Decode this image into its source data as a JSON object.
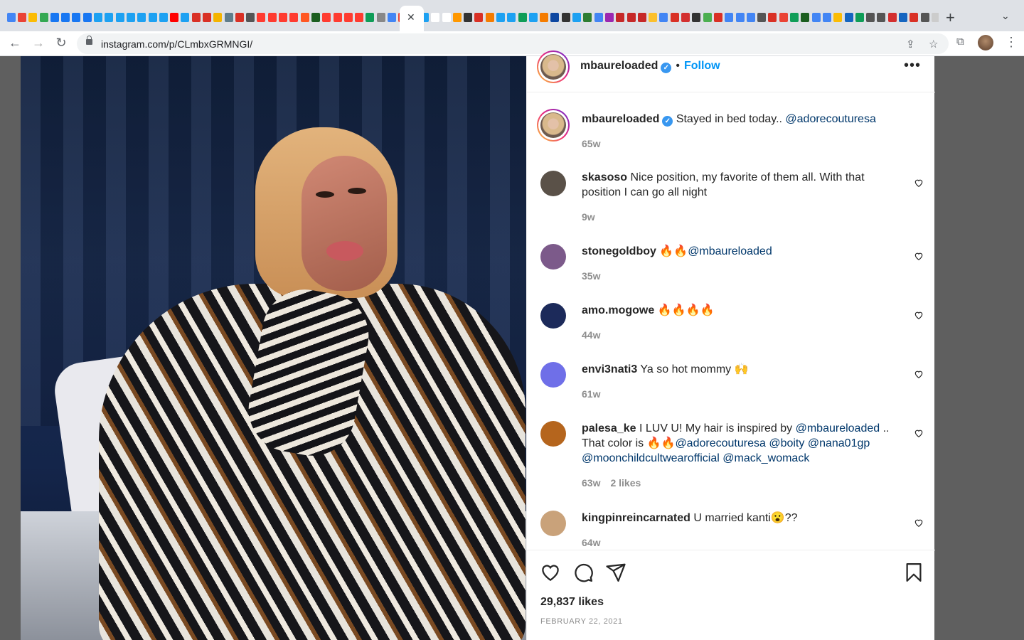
{
  "browser": {
    "url": "instagram.com/p/CLmbxGRMNGI/",
    "tab_close": "✕",
    "new_tab": "+",
    "tab_search": "⌄",
    "back": "←",
    "forward": "→",
    "reload": "↻",
    "share": "⇪",
    "bookmark": "☆",
    "extensions": "⧉",
    "menu": "⋮",
    "tab_favicon_colors": [
      "#4285f4",
      "#ea4335",
      "#fbbc05",
      "#34a853",
      "#1877f2",
      "#1877f2",
      "#1877f2",
      "#1877f2",
      "#1da1f2",
      "#1da1f2",
      "#1da1f2",
      "#1da1f2",
      "#1da1f2",
      "#1da1f2",
      "#1da1f2",
      "#ff0000",
      "#1da1f2",
      "#d93025",
      "#d93025",
      "#f4b400",
      "#607d8b",
      "#d93025",
      "#555555",
      "#ff3b30",
      "#ff3b30",
      "#ff3b30",
      "#ff3b30",
      "#ff5722",
      "#1b5e20",
      "#ff3b30",
      "#ff3b30",
      "#ff3b30",
      "#ff3b30",
      "#0f9d58",
      "#888888",
      "#4285f4",
      "#ea4335",
      "#f4b400",
      "#1da1f2"
    ],
    "tab_favicon_colors_right": [
      "#ff9800",
      "#333333",
      "#d93025",
      "#f57c00",
      "#1da1f2",
      "#1da1f2",
      "#0f9d58",
      "#1da1f2",
      "#f57c00",
      "#0d47a1",
      "#333333",
      "#1da1f2",
      "#2e7d32",
      "#4285f4",
      "#9c27b0",
      "#c62828",
      "#c62828",
      "#c62828",
      "#fbc02d",
      "#4285f4",
      "#d93025",
      "#d32f2f",
      "#333333",
      "#4caf50",
      "#d93025",
      "#4285f4",
      "#4285f4",
      "#4285f4",
      "#555555",
      "#d93025",
      "#ea4335",
      "#0f9d58",
      "#1b5e20",
      "#4285f4",
      "#4285f4",
      "#fbbc05",
      "#1565c0",
      "#0f9d58",
      "#555555",
      "#555555",
      "#d32f2f",
      "#1565c0",
      "#d93025",
      "#555555",
      "#cccccc",
      "#d32f2f",
      "#4caf50",
      "#111111"
    ]
  },
  "post": {
    "author": "mbaureloaded",
    "dot": "•",
    "follow_label": "Follow",
    "more": "•••",
    "likes": "29,837 likes",
    "date": "FEBRUARY 22, 2021"
  },
  "comments": [
    {
      "user": "mbaureloaded",
      "verified": true,
      "text": "Stayed in bed today.. ",
      "mentions": [
        "@adorecouturesa"
      ],
      "age": "65w",
      "likes": "",
      "avatar_color": "#d8b48a"
    },
    {
      "user": "skasoso",
      "text": "Nice position, my favorite of them all. With that position I can go all night",
      "age": "9w",
      "likes": "",
      "avatar_color": "#5a5148"
    },
    {
      "user": "stonegoldboy",
      "text": "🔥🔥",
      "mentions": [
        "@mbaureloaded"
      ],
      "age": "35w",
      "likes": "",
      "avatar_color": "#7c5a8a"
    },
    {
      "user": "amo.mogowe",
      "text": "🔥🔥🔥🔥",
      "age": "44w",
      "likes": "",
      "avatar_color": "#1c2a5a"
    },
    {
      "user": "envi3nati3",
      "text": "Ya so hot mommy 🙌",
      "age": "61w",
      "likes": "",
      "avatar_color": "#6f6fe8"
    },
    {
      "user": "palesa_ke",
      "text": "I LUV U! My hair is inspired by ",
      "m1": "@mbaureloaded",
      "text2": " .. That color is 🔥🔥",
      "m2": "@adorecouturesa",
      "m3": "@boity",
      "m4": "@nana01gp",
      "m5": "@moonchildcultwearofficial",
      "m6": "@mack_womack",
      "age": "63w",
      "likes": "2 likes",
      "avatar_color": "#b5651d"
    },
    {
      "user": "kingpinreincarnated",
      "text": "U married kanti😮??",
      "age": "64w",
      "likes": "",
      "avatar_color": "#c9a27a"
    }
  ],
  "icons": {
    "like": "heart-icon",
    "comment": "comment-icon",
    "share": "paper-plane-icon",
    "save": "bookmark-icon"
  }
}
